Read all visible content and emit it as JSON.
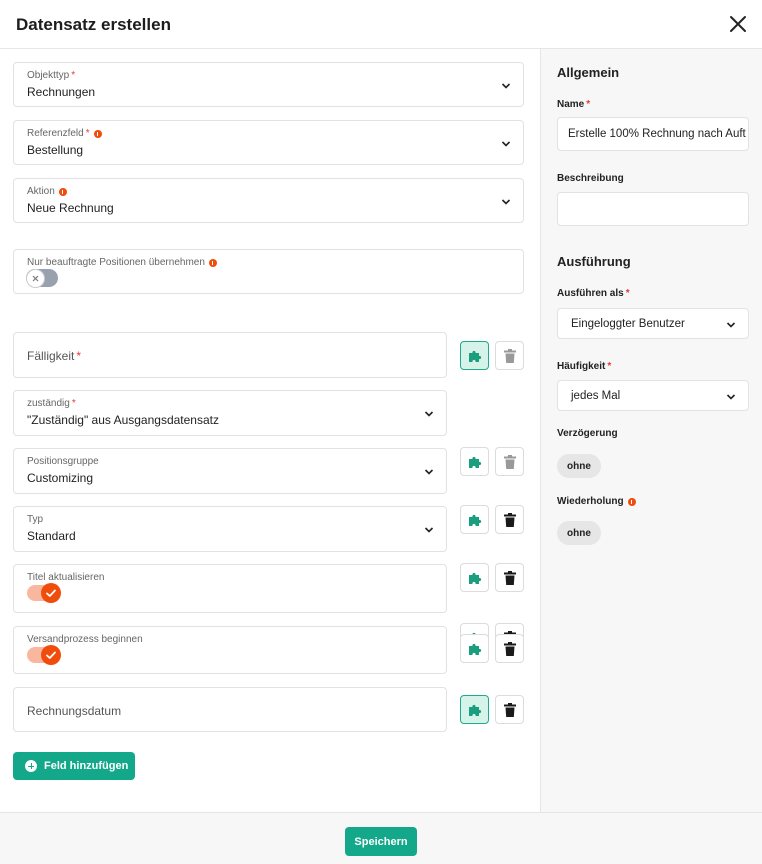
{
  "dialog": {
    "title": "Datensatz erstellen"
  },
  "colors": {
    "accent": "#13a88a",
    "warning": "#f04c0c",
    "required": "#e53935"
  },
  "main": {
    "objekttyp": {
      "label": "Objekttyp",
      "value": "Rechnungen"
    },
    "referenzfeld": {
      "label": "Referenzfeld",
      "value": "Bestellung"
    },
    "aktion": {
      "label": "Aktion",
      "value": "Neue Rechnung"
    },
    "nur_beauftragte": {
      "label": "Nur beauftragte Positionen übernehmen",
      "checked": false
    },
    "fields": [
      {
        "label": "Fälligkeit",
        "required": true,
        "empty": true
      },
      {
        "label": "zuständig",
        "value": "\"Zuständig\" aus Ausgangsdatensatz",
        "required": true
      },
      {
        "label": "Positionsgruppe",
        "value": "Customizing"
      },
      {
        "label": "Typ",
        "value": "Standard"
      },
      {
        "label": "Titel aktualisieren",
        "checked": true
      },
      {
        "label": "Versandprozess beginnen",
        "checked": true
      },
      {
        "label": "Rechnungsdatum",
        "empty": true
      }
    ],
    "add_field_label": "Feld hinzufügen"
  },
  "sidebar": {
    "allgemein_heading": "Allgemein",
    "name_label": "Name",
    "name_value": "Erstelle 100% Rechnung nach Auft",
    "beschreibung_label": "Beschreibung",
    "beschreibung_value": "",
    "ausfuehrung_heading": "Ausführung",
    "ausfuehren_als_label": "Ausführen als",
    "ausfuehren_als_value": "Eingeloggter Benutzer",
    "haeufigkeit_label": "Häufigkeit",
    "haeufigkeit_value": "jedes Mal",
    "verzoegerung_label": "Verzögerung",
    "verzoegerung_value": "ohne",
    "wiederholung_label": "Wiederholung",
    "wiederholung_value": "ohne"
  },
  "footer": {
    "save_label": "Speichern"
  }
}
